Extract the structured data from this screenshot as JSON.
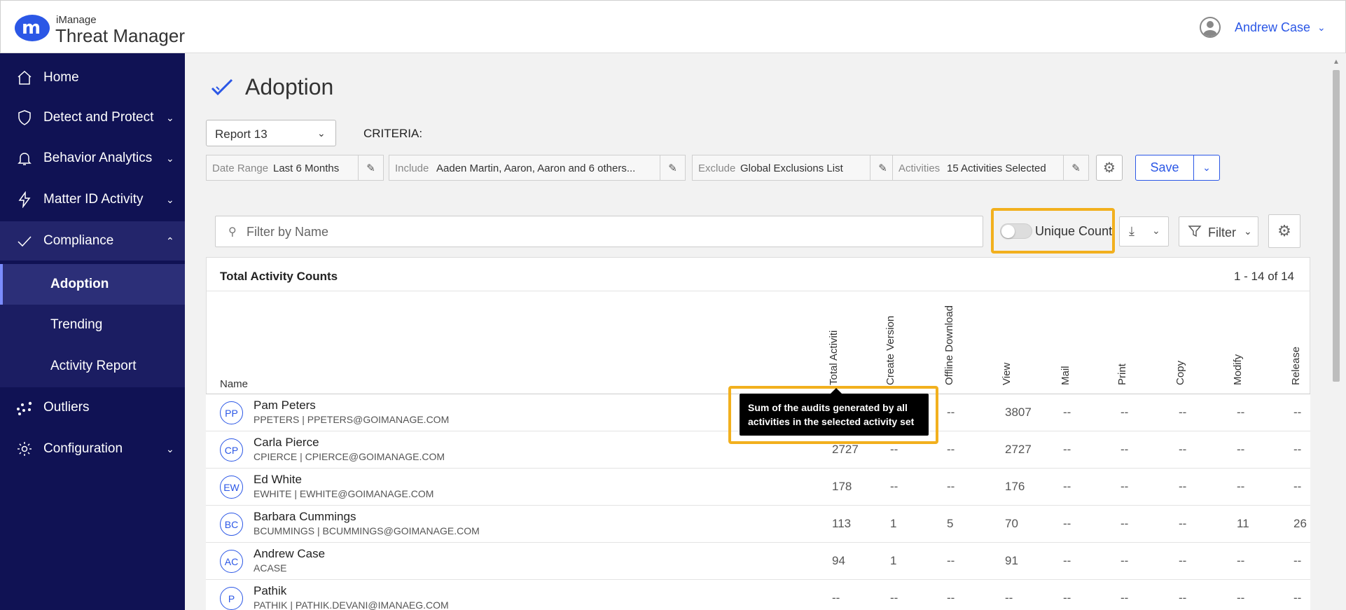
{
  "header": {
    "brand_small": "iManage",
    "brand_big": "Threat Manager",
    "logo_letter": "m",
    "user_name": "Andrew Case"
  },
  "sidebar": {
    "items": [
      {
        "label": "Home",
        "icon": "home-icon"
      },
      {
        "label": "Detect and Protect",
        "icon": "shield-icon"
      },
      {
        "label": "Behavior Analytics",
        "icon": "bell-icon"
      },
      {
        "label": "Matter ID Activity",
        "icon": "bolt-icon"
      },
      {
        "label": "Compliance",
        "icon": "check-icon"
      },
      {
        "label": "Outliers",
        "icon": "scatter-icon"
      },
      {
        "label": "Configuration",
        "icon": "gear-icon"
      }
    ],
    "sub_items": [
      {
        "label": "Adoption"
      },
      {
        "label": "Trending"
      },
      {
        "label": "Activity Report"
      }
    ]
  },
  "page": {
    "title": "Adoption",
    "report_select": "Report 13",
    "criteria_label": "CRITERIA:",
    "criteria": [
      {
        "key": "Date Range",
        "value": "Last 6 Months"
      },
      {
        "key": "Include",
        "value": "Aaden Martin, Aaron, Aaron and 6 others..."
      },
      {
        "key": "Exclude",
        "value": "Global Exclusions List"
      },
      {
        "key": "Activities",
        "value": "15 Activities Selected"
      }
    ],
    "save_label": "Save"
  },
  "toolbar": {
    "search_placeholder": "Filter by Name",
    "unique_count_label": "Unique Count",
    "unique_count_on": false,
    "filter_label": "Filter"
  },
  "table": {
    "title": "Total Activity Counts",
    "range": "1 - 14 of 14",
    "name_header": "Name",
    "columns": [
      "Total Activiti",
      "Create Version",
      "Offline Download",
      "View",
      "Mail",
      "Print",
      "Copy",
      "Modify",
      "Release"
    ],
    "rows": [
      {
        "initials": "PP",
        "name": "Pam Peters",
        "sub": "PPETERS | PPETERS@GOIMANAGE.COM",
        "values": [
          "",
          "",
          "--",
          "3807",
          "--",
          "--",
          "--",
          "--",
          "--"
        ]
      },
      {
        "initials": "CP",
        "name": "Carla Pierce",
        "sub": "CPIERCE | CPIERCE@GOIMANAGE.COM",
        "values": [
          "2727",
          "--",
          "--",
          "2727",
          "--",
          "--",
          "--",
          "--",
          "--"
        ]
      },
      {
        "initials": "EW",
        "name": "Ed White",
        "sub": "EWHITE | EWHITE@GOIMANAGE.COM",
        "values": [
          "178",
          "--",
          "--",
          "176",
          "--",
          "--",
          "--",
          "--",
          "--"
        ]
      },
      {
        "initials": "BC",
        "name": "Barbara Cummings",
        "sub": "BCUMMINGS | BCUMMINGS@GOIMANAGE.COM",
        "values": [
          "113",
          "1",
          "5",
          "70",
          "--",
          "--",
          "--",
          "11",
          "26"
        ]
      },
      {
        "initials": "AC",
        "name": "Andrew Case",
        "sub": "ACASE",
        "values": [
          "94",
          "1",
          "--",
          "91",
          "--",
          "--",
          "--",
          "--",
          "--"
        ]
      },
      {
        "initials": "P",
        "name": "Pathik",
        "sub": "PATHIK | PATHIK.DEVANI@IMANAEG.COM",
        "values": [
          "--",
          "--",
          "--",
          "--",
          "--",
          "--",
          "--",
          "--",
          "--"
        ]
      }
    ]
  },
  "tooltip": {
    "text": "Sum of the audits generated by all activities in the selected activity set"
  },
  "colors": {
    "sidebar": "#101254",
    "accent": "#2b57e6",
    "highlight": "#f2b01e"
  }
}
